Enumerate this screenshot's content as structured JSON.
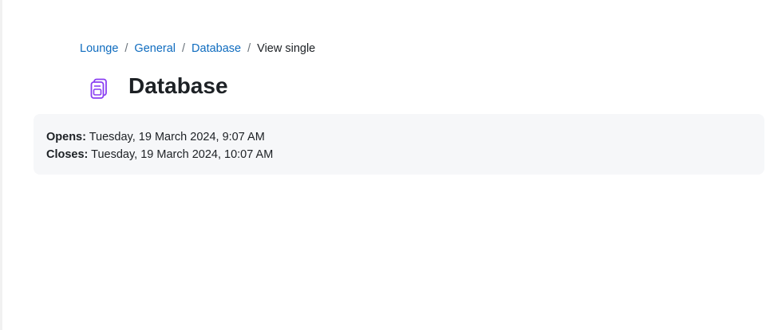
{
  "breadcrumb": {
    "items": [
      {
        "label": "Lounge"
      },
      {
        "label": "General"
      },
      {
        "label": "Database"
      }
    ],
    "separator": "/",
    "current": "View single"
  },
  "header": {
    "icon": "database-activity-icon",
    "icon_color": "#8a3ff2",
    "title": "Database"
  },
  "dates": {
    "opens_label": "Opens:",
    "opens_value": "Tuesday, 19 March 2024, 9:07 AM",
    "closes_label": "Closes:",
    "closes_value": "Tuesday, 19 March 2024, 10:07 AM"
  },
  "colors": {
    "link": "#0f6cbf",
    "text": "#1d2125",
    "box_bg": "#f6f7f9"
  }
}
